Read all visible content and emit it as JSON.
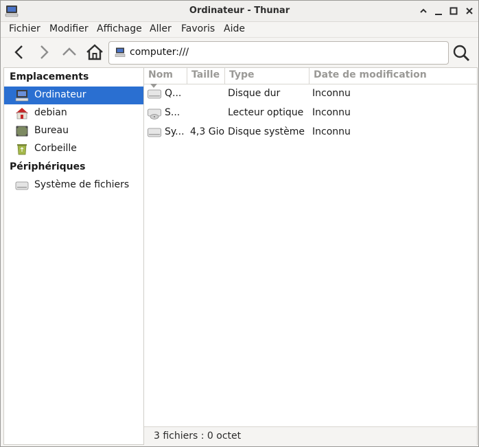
{
  "window": {
    "title": "Ordinateur - Thunar"
  },
  "menubar": {
    "items": [
      "Fichier",
      "Modifier",
      "Affichage",
      "Aller",
      "Favoris",
      "Aide"
    ]
  },
  "toolbar": {
    "location": "computer:///"
  },
  "sidebar": {
    "sections": [
      {
        "label": "Emplacements"
      },
      {
        "label": "Périphériques"
      }
    ],
    "places": [
      {
        "label": "Ordinateur",
        "icon": "computer-icon",
        "selected": true
      },
      {
        "label": "debian",
        "icon": "home-folder-icon"
      },
      {
        "label": "Bureau",
        "icon": "desktop-icon"
      },
      {
        "label": "Corbeille",
        "icon": "trash-icon"
      }
    ],
    "devices": [
      {
        "label": "Système de fichiers",
        "icon": "drive-icon"
      }
    ]
  },
  "table": {
    "columns": [
      "Nom",
      "Taille",
      "Type",
      "Date de modification"
    ],
    "rows": [
      {
        "name": "Q...",
        "size": "",
        "type": "Disque dur",
        "date": "Inconnu",
        "icon": "harddisk-icon"
      },
      {
        "name": "S...",
        "size": "",
        "type": "Lecteur optique",
        "date": "Inconnu",
        "icon": "optical-drive-icon"
      },
      {
        "name": "Sy...",
        "size": "4,3 Gio",
        "type": "Disque système",
        "date": "Inconnu",
        "icon": "harddisk-icon"
      }
    ]
  },
  "status": {
    "text": "3 fichiers : 0 octet"
  },
  "colors": {
    "selection": "#2a6fd1"
  }
}
